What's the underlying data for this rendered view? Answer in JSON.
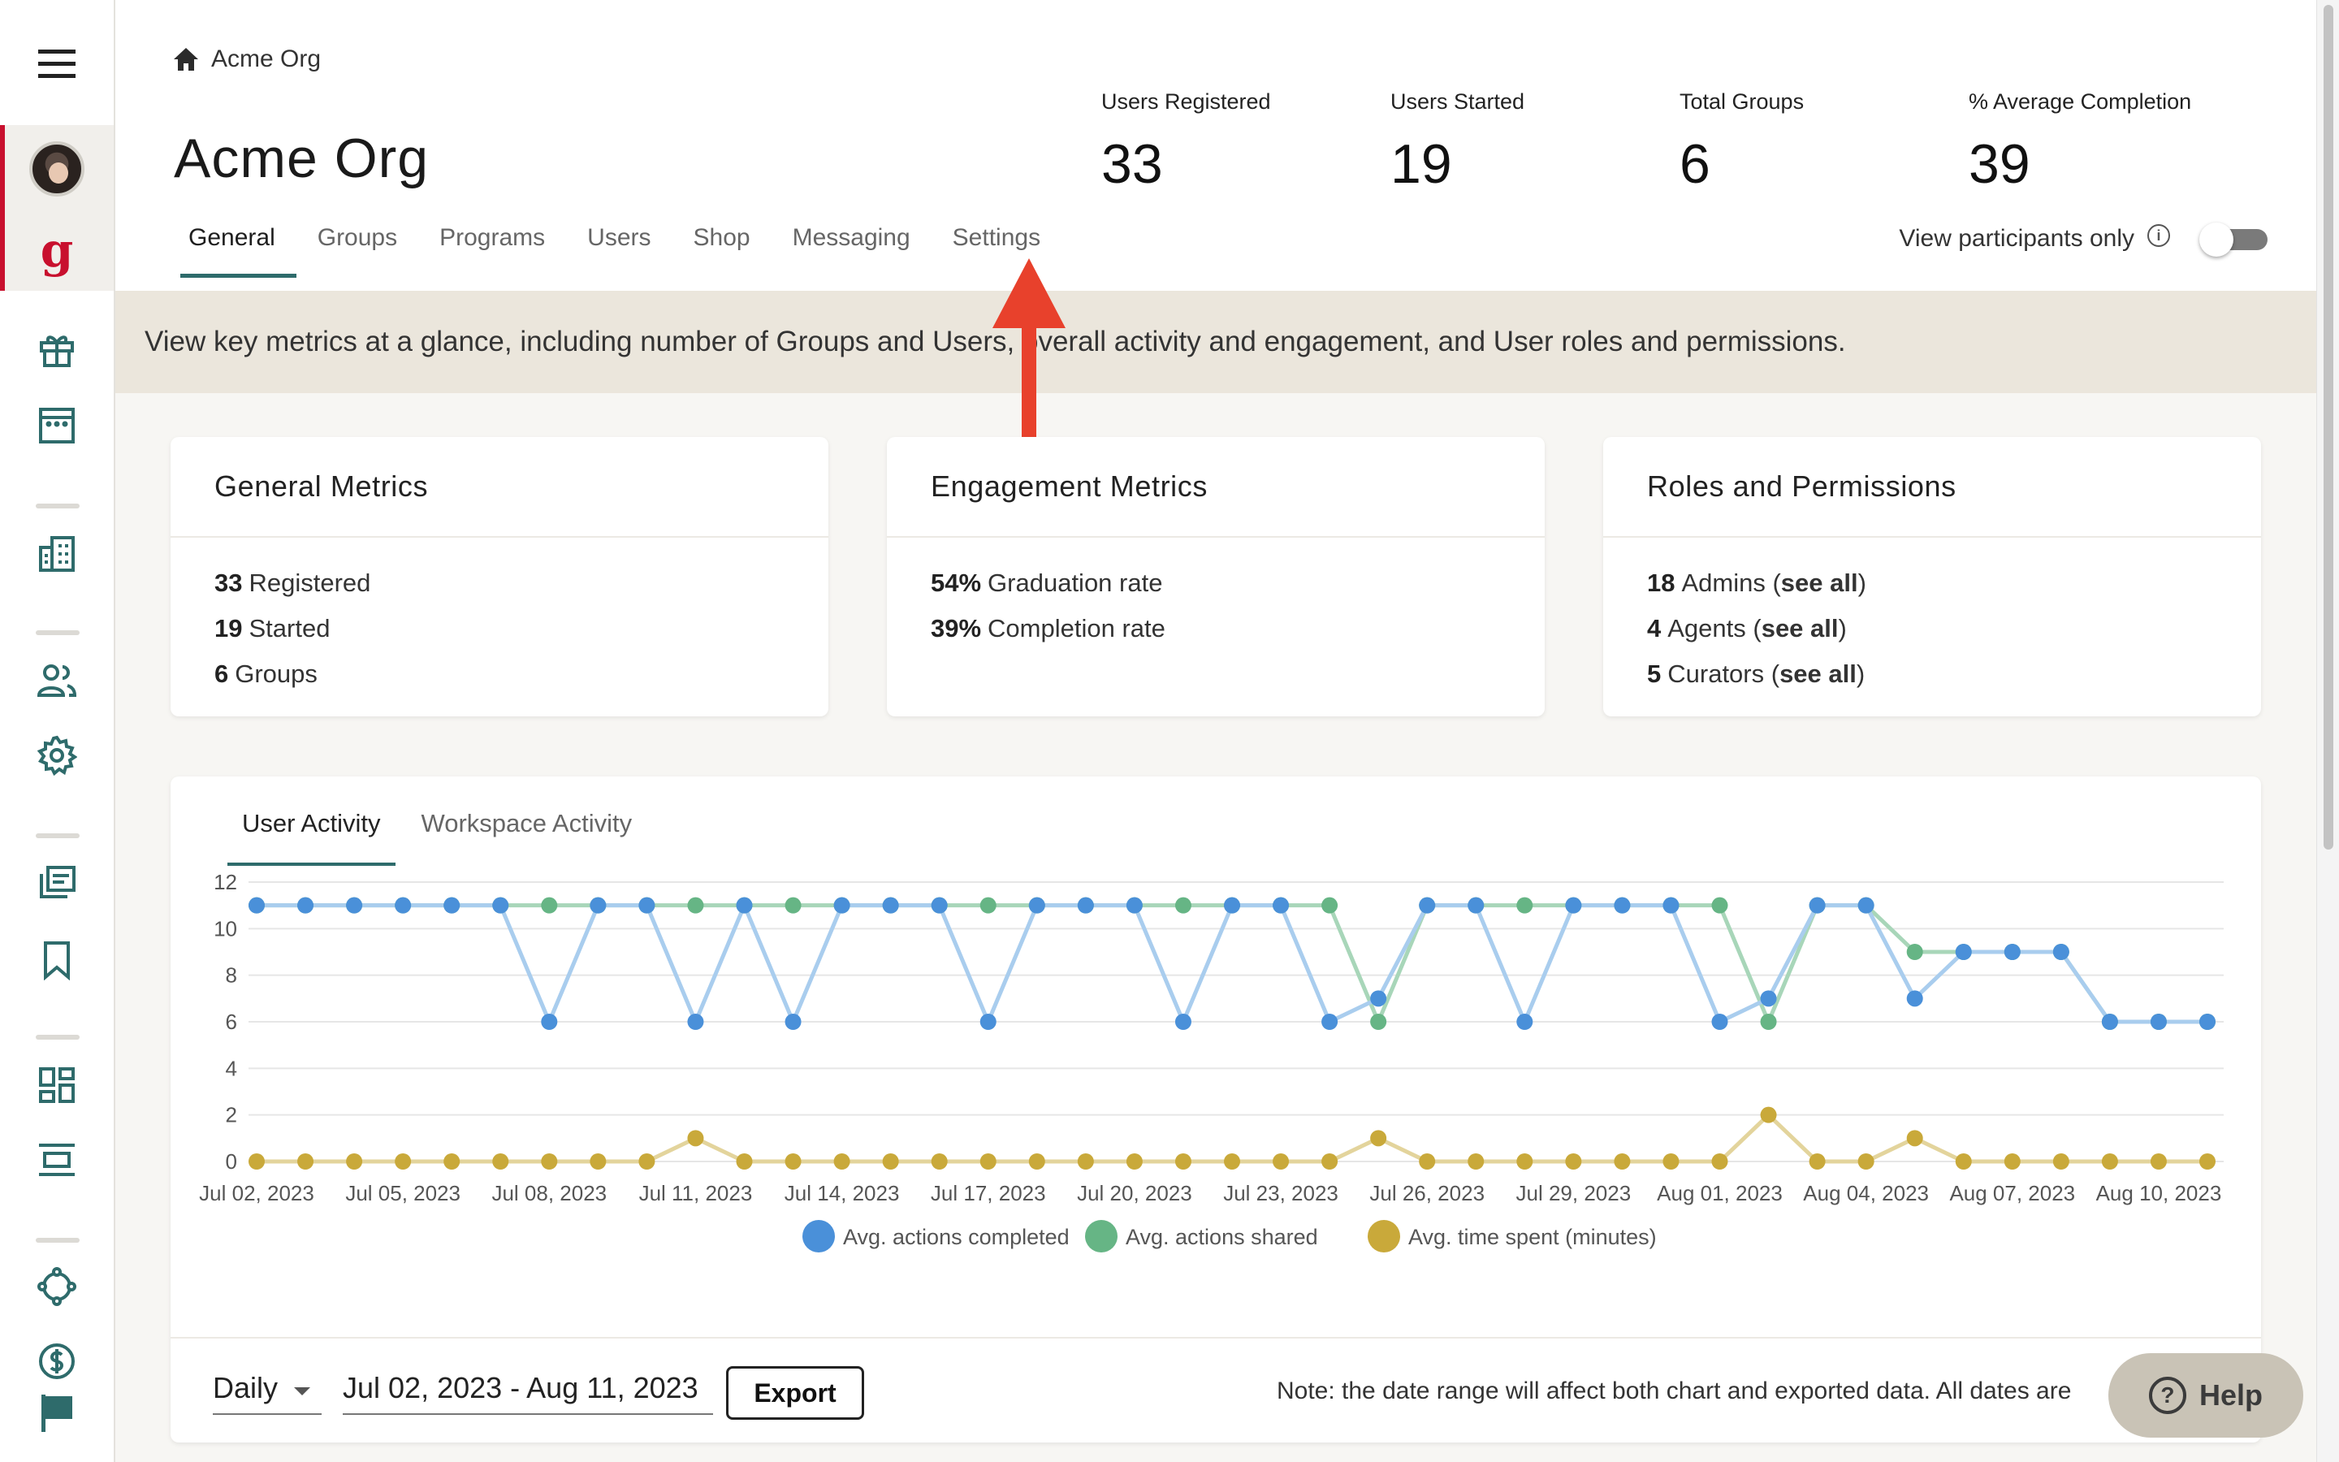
{
  "breadcrumb": {
    "label": "Acme Org"
  },
  "page": {
    "title": "Acme Org"
  },
  "stats": [
    {
      "label": "Users Registered",
      "value": "33"
    },
    {
      "label": "Users Started",
      "value": "19"
    },
    {
      "label": "Total Groups",
      "value": "6"
    },
    {
      "label": "% Average Completion",
      "value": "39"
    }
  ],
  "tabs": [
    "General",
    "Groups",
    "Programs",
    "Users",
    "Shop",
    "Messaging",
    "Settings"
  ],
  "active_tab": "General",
  "view_participants": {
    "label": "View participants only",
    "enabled": false
  },
  "banner": {
    "text": "View key metrics at a glance, including number of Groups and Users, overall activity and engagement, and User roles and permissions."
  },
  "cards": {
    "general": {
      "title": "General Metrics",
      "lines": [
        {
          "value": "33",
          "text": "Registered"
        },
        {
          "value": "19",
          "text": "Started"
        },
        {
          "value": "6",
          "text": "Groups"
        }
      ]
    },
    "engagement": {
      "title": "Engagement Metrics",
      "lines": [
        {
          "value": "54%",
          "text": "Graduation rate"
        },
        {
          "value": "39%",
          "text": "Completion rate"
        }
      ]
    },
    "roles": {
      "title": "Roles and Permissions",
      "lines": [
        {
          "value": "18",
          "text": "Admins (",
          "link": "see all",
          "close": ")"
        },
        {
          "value": "4",
          "text": "Agents (",
          "link": "see all",
          "close": ")"
        },
        {
          "value": "5",
          "text": "Curators (",
          "link": "see all",
          "close": ")"
        }
      ]
    }
  },
  "activity": {
    "tabs": [
      "User Activity",
      "Workspace Activity"
    ],
    "active_tab": "User Activity",
    "interval": "Daily",
    "date_range": "Jul 02, 2023 - Aug 11, 2023",
    "export_label": "Export",
    "note": "Note: the date range will affect both chart and exported data. All dates are"
  },
  "help": {
    "label": "Help"
  },
  "chart_data": {
    "type": "line",
    "title": "",
    "xlabel": "",
    "ylabel": "",
    "ylim": [
      0,
      12
    ],
    "yticks": [
      0,
      2,
      4,
      6,
      8,
      10,
      12
    ],
    "grid": true,
    "legend_position": "bottom-center",
    "x": [
      "Jul 02, 2023",
      "Jul 03, 2023",
      "Jul 04, 2023",
      "Jul 05, 2023",
      "Jul 06, 2023",
      "Jul 07, 2023",
      "Jul 08, 2023",
      "Jul 09, 2023",
      "Jul 10, 2023",
      "Jul 11, 2023",
      "Jul 12, 2023",
      "Jul 13, 2023",
      "Jul 14, 2023",
      "Jul 15, 2023",
      "Jul 16, 2023",
      "Jul 17, 2023",
      "Jul 18, 2023",
      "Jul 19, 2023",
      "Jul 20, 2023",
      "Jul 21, 2023",
      "Jul 22, 2023",
      "Jul 23, 2023",
      "Jul 24, 2023",
      "Jul 25, 2023",
      "Jul 26, 2023",
      "Jul 27, 2023",
      "Jul 28, 2023",
      "Jul 29, 2023",
      "Jul 30, 2023",
      "Jul 31, 2023",
      "Aug 01, 2023",
      "Aug 02, 2023",
      "Aug 03, 2023",
      "Aug 04, 2023",
      "Aug 05, 2023",
      "Aug 06, 2023",
      "Aug 07, 2023",
      "Aug 08, 2023",
      "Aug 09, 2023",
      "Aug 10, 2023",
      "Aug 11, 2023"
    ],
    "xtick_labels": [
      "Jul 02, 2023",
      "Jul 05, 2023",
      "Jul 08, 2023",
      "Jul 11, 2023",
      "Jul 14, 2023",
      "Jul 17, 2023",
      "Jul 20, 2023",
      "Jul 23, 2023",
      "Jul 26, 2023",
      "Jul 29, 2023",
      "Aug 01, 2023",
      "Aug 04, 2023",
      "Aug 07, 2023",
      "Aug 10, 2023"
    ],
    "series": [
      {
        "name": "Avg. actions shared",
        "color": "#66b585",
        "values": [
          11,
          11,
          11,
          11,
          11,
          11,
          11,
          11,
          11,
          11,
          11,
          11,
          11,
          11,
          11,
          11,
          11,
          11,
          11,
          11,
          11,
          11,
          11,
          6,
          11,
          11,
          11,
          11,
          11,
          11,
          11,
          6,
          11,
          11,
          9,
          9,
          9,
          9,
          6,
          6,
          6
        ]
      },
      {
        "name": "Avg. actions completed",
        "color": "#4a90d9",
        "values": [
          11,
          11,
          11,
          11,
          11,
          11,
          6,
          11,
          11,
          6,
          11,
          6,
          11,
          11,
          11,
          6,
          11,
          11,
          11,
          6,
          11,
          11,
          6,
          7,
          11,
          11,
          6,
          11,
          11,
          11,
          6,
          7,
          11,
          11,
          7,
          9,
          9,
          9,
          6,
          6,
          6
        ]
      },
      {
        "name": "Avg. time spent (minutes)",
        "color": "#c9a93a",
        "values": [
          0,
          0,
          0,
          0,
          0,
          0,
          0,
          0,
          0,
          1,
          0,
          0,
          0,
          0,
          0,
          0,
          0,
          0,
          0,
          0,
          0,
          0,
          0,
          1,
          0,
          0,
          0,
          0,
          0,
          0,
          0,
          2,
          0,
          0,
          1,
          0,
          0,
          0,
          0,
          0,
          0
        ]
      }
    ],
    "legend_order": [
      "Avg. actions completed",
      "Avg. actions shared",
      "Avg. time spent (minutes)"
    ]
  },
  "colors": {
    "accent": "#2e6b6b",
    "brand": "#c8102e",
    "banner": "#ebe6dc",
    "annotation_arrow": "#e8412c"
  },
  "icons": [
    "menu-icon",
    "brand-icon",
    "gift-icon",
    "calendar-icon",
    "building-icon",
    "users-icon",
    "gear-icon",
    "library-icon",
    "bookmark-icon",
    "dashboard-icon",
    "layout-icon",
    "network-icon",
    "dollar-icon",
    "flag-icon",
    "home-icon",
    "info-icon",
    "help-icon"
  ]
}
